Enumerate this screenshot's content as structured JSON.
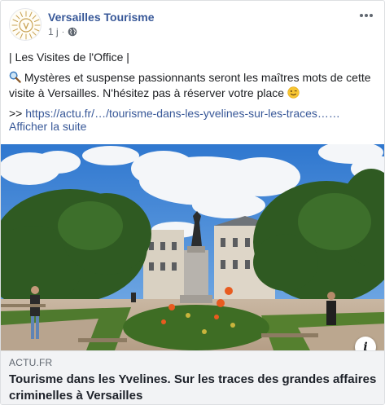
{
  "post": {
    "page_name": "Versailles Tourisme",
    "time": "1 j",
    "separator": "·",
    "privacy_icon": "globe-icon",
    "more_icon": "more-options-icon",
    "text": {
      "line1": "| Les Visites de l'Office |",
      "line2_icon": "magnifier-icon",
      "line2": "Mystères et suspense passionnants seront les maîtres mots de cette visite à Versailles. N'hésitez pas à réserver votre place",
      "line2_emoji": "winking-face-emoji",
      "link_prefix": ">>",
      "link": "https://actu.fr/…/tourisme-dans-les-yvelines-sur-les-traces……",
      "see_more": "Afficher la suite"
    }
  },
  "link_preview": {
    "domain": "ACTU.FR",
    "title": "Tourisme dans les Yvelines. Sur les traces des grandes affaires criminelles à Versailles",
    "info_label": "i",
    "info_icon": "info-icon"
  },
  "colors": {
    "link_blue": "#385898",
    "text_dark": "#1c1e21",
    "meta_gray": "#606770",
    "caption_bg": "#f2f3f5",
    "sky": "#3f86d6"
  }
}
